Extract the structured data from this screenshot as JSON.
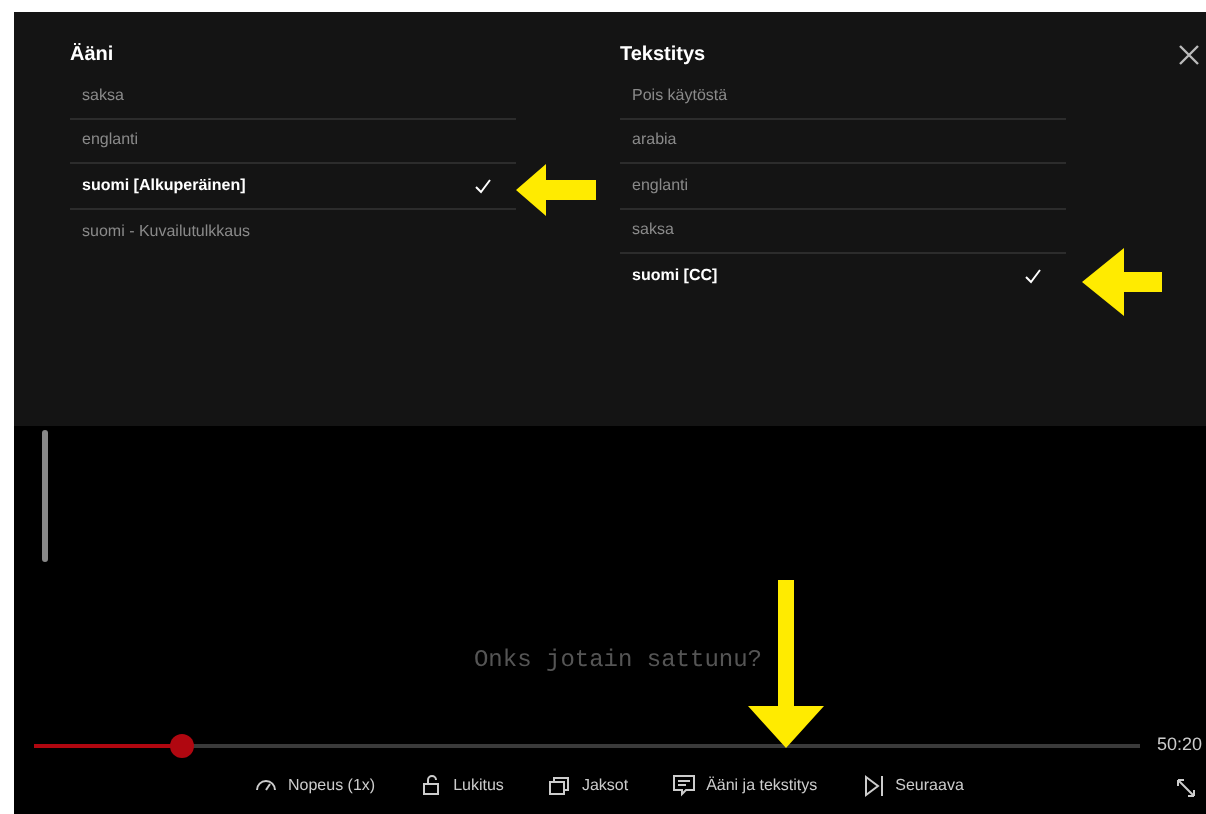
{
  "audio": {
    "title": "Ääni",
    "items": [
      {
        "label": "saksa",
        "selected": false
      },
      {
        "label": "englanti",
        "selected": false
      },
      {
        "label": "suomi [Alkuperäinen]",
        "selected": true
      },
      {
        "label": "suomi - Kuvailutulkkaus",
        "selected": false
      }
    ]
  },
  "subtitles": {
    "title": "Tekstitys",
    "items": [
      {
        "label": "Pois käytöstä",
        "selected": false
      },
      {
        "label": "arabia",
        "selected": false
      },
      {
        "label": "englanti",
        "selected": false
      },
      {
        "label": "saksa",
        "selected": false
      },
      {
        "label": "suomi [CC]",
        "selected": true
      }
    ]
  },
  "caption": "Onks jotain sattunu?",
  "progress": {
    "level": 0.133,
    "remaining": "50:20"
  },
  "controls": [
    {
      "kind": "speed",
      "label": "Nopeus (1x)"
    },
    {
      "kind": "lock",
      "label": "Lukitus"
    },
    {
      "kind": "episodes",
      "label": "Jaksot"
    },
    {
      "kind": "audio",
      "label": "Ääni ja tekstitys"
    },
    {
      "kind": "next",
      "label": "Seuraava"
    }
  ]
}
